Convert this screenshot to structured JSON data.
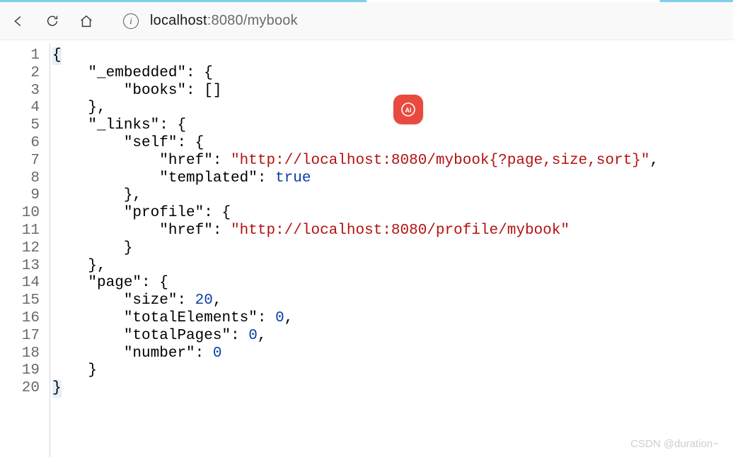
{
  "toolbar": {
    "url_host": "localhost",
    "url_port": ":8080",
    "url_path": "/mybook"
  },
  "code": {
    "line_count": 20,
    "lines": [
      {
        "indent": 0,
        "tokens": [
          {
            "t": "punc",
            "v": "{",
            "hl": true
          }
        ]
      },
      {
        "indent": 1,
        "tokens": [
          {
            "t": "key",
            "v": "\"_embedded\""
          },
          {
            "t": "punc",
            "v": ": {"
          }
        ]
      },
      {
        "indent": 2,
        "tokens": [
          {
            "t": "key",
            "v": "\"books\""
          },
          {
            "t": "punc",
            "v": ": []"
          }
        ]
      },
      {
        "indent": 1,
        "tokens": [
          {
            "t": "punc",
            "v": "},"
          }
        ]
      },
      {
        "indent": 1,
        "tokens": [
          {
            "t": "key",
            "v": "\"_links\""
          },
          {
            "t": "punc",
            "v": ": {"
          }
        ]
      },
      {
        "indent": 2,
        "tokens": [
          {
            "t": "key",
            "v": "\"self\""
          },
          {
            "t": "punc",
            "v": ": {"
          }
        ]
      },
      {
        "indent": 3,
        "tokens": [
          {
            "t": "key",
            "v": "\"href\""
          },
          {
            "t": "punc",
            "v": ": "
          },
          {
            "t": "str",
            "v": "\"http://localhost:8080/mybook{?page,size,sort}\""
          },
          {
            "t": "punc",
            "v": ","
          }
        ]
      },
      {
        "indent": 3,
        "tokens": [
          {
            "t": "key",
            "v": "\"templated\""
          },
          {
            "t": "punc",
            "v": ": "
          },
          {
            "t": "bool",
            "v": "true"
          }
        ]
      },
      {
        "indent": 2,
        "tokens": [
          {
            "t": "punc",
            "v": "},"
          }
        ]
      },
      {
        "indent": 2,
        "tokens": [
          {
            "t": "key",
            "v": "\"profile\""
          },
          {
            "t": "punc",
            "v": ": {"
          }
        ]
      },
      {
        "indent": 3,
        "tokens": [
          {
            "t": "key",
            "v": "\"href\""
          },
          {
            "t": "punc",
            "v": ": "
          },
          {
            "t": "str",
            "v": "\"http://localhost:8080/profile/mybook\""
          }
        ]
      },
      {
        "indent": 2,
        "tokens": [
          {
            "t": "punc",
            "v": "}"
          }
        ]
      },
      {
        "indent": 1,
        "tokens": [
          {
            "t": "punc",
            "v": "},"
          }
        ]
      },
      {
        "indent": 1,
        "tokens": [
          {
            "t": "key",
            "v": "\"page\""
          },
          {
            "t": "punc",
            "v": ": {"
          }
        ]
      },
      {
        "indent": 2,
        "tokens": [
          {
            "t": "key",
            "v": "\"size\""
          },
          {
            "t": "punc",
            "v": ": "
          },
          {
            "t": "num",
            "v": "20"
          },
          {
            "t": "punc",
            "v": ","
          }
        ]
      },
      {
        "indent": 2,
        "tokens": [
          {
            "t": "key",
            "v": "\"totalElements\""
          },
          {
            "t": "punc",
            "v": ": "
          },
          {
            "t": "num",
            "v": "0"
          },
          {
            "t": "punc",
            "v": ","
          }
        ]
      },
      {
        "indent": 2,
        "tokens": [
          {
            "t": "key",
            "v": "\"totalPages\""
          },
          {
            "t": "punc",
            "v": ": "
          },
          {
            "t": "num",
            "v": "0"
          },
          {
            "t": "punc",
            "v": ","
          }
        ]
      },
      {
        "indent": 2,
        "tokens": [
          {
            "t": "key",
            "v": "\"number\""
          },
          {
            "t": "punc",
            "v": ": "
          },
          {
            "t": "num",
            "v": "0"
          }
        ]
      },
      {
        "indent": 1,
        "tokens": [
          {
            "t": "punc",
            "v": "}"
          }
        ]
      },
      {
        "indent": 0,
        "tokens": [
          {
            "t": "punc",
            "v": "}",
            "hl": true
          }
        ]
      }
    ]
  },
  "badge": {
    "label": "AI"
  },
  "watermark": "CSDN @duration~"
}
